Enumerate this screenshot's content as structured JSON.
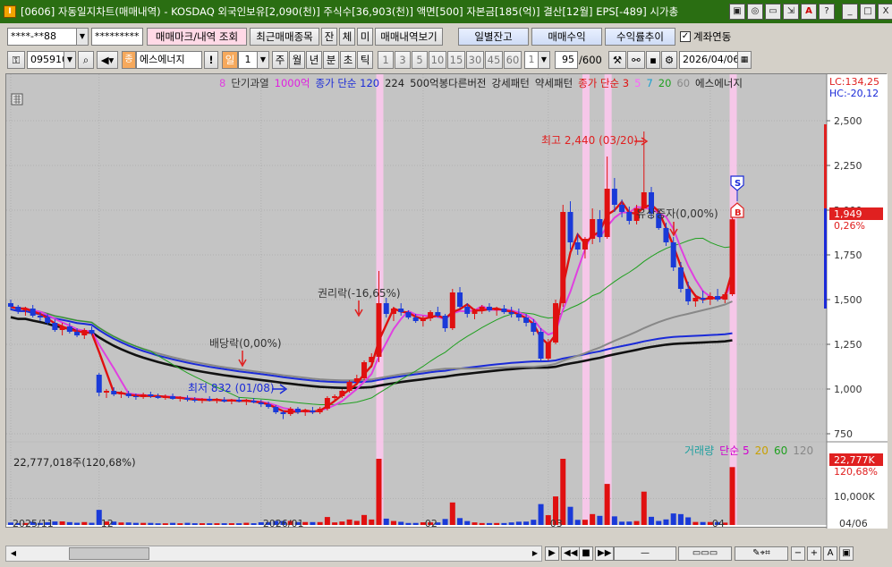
{
  "window": {
    "title": "[0606] 자동일지차트(매매내역) - KOSDAQ 외국인보유[2,090(천)] 주식수[36,903(천)] 액면[500] 자본금[185(억)] 결산[12월] EPS[-489] 시가총",
    "app_icon": "I",
    "buttons": [
      "▣",
      "◎",
      "▭",
      "⇲",
      "A",
      "?",
      "_",
      "□",
      "X"
    ]
  },
  "toolbar1": {
    "account_masked": "****-**88",
    "password_masked": "*********",
    "trade_mark_button": "매매마크/내역 조회",
    "recent_trades_button": "최근매매종목",
    "tab_jan": "잔",
    "tab_che": "체",
    "tab_mi": "미",
    "trade_history_button": "매매내역보기",
    "daily_balance_button": "일별잔고",
    "trade_profit_button": "매매수익",
    "return_trend_button": "수익률추이",
    "account_link_label": "계좌연동",
    "account_link_checked": "✓"
  },
  "toolbar2": {
    "stock_code": "095910",
    "stock_name": "에스에너지",
    "stock_badge": "종",
    "period_selected": "일",
    "period_count": "1",
    "periods": [
      "주",
      "월",
      "년",
      "분",
      "초",
      "틱"
    ],
    "intervals": [
      "1",
      "3",
      "5",
      "10",
      "15",
      "30",
      "45",
      "60"
    ],
    "interval_count": "1",
    "bar_count": "95",
    "bar_total": "/600",
    "date": "2026/04/06"
  },
  "chart_data": [
    {
      "type": "candlestick",
      "legend": [
        {
          "text": "8",
          "color": "#e040e0"
        },
        {
          "text": "단기과열",
          "color": "#333333"
        },
        {
          "text": "1000억",
          "color": "#e020e0"
        },
        {
          "text": "종가 단순 120",
          "color": "#1a2ad8"
        },
        {
          "text": "224",
          "color": "#222222"
        },
        {
          "text": "500억봉다른버전",
          "color": "#222222"
        },
        {
          "text": "강세패턴",
          "color": "#222222"
        },
        {
          "text": "약세패턴",
          "color": "#222222"
        },
        {
          "text": "종가 단순 3",
          "color": "#e01010"
        },
        {
          "text": "5",
          "color": "#ff60ff"
        },
        {
          "text": "7",
          "color": "#18a0d0"
        },
        {
          "text": "20",
          "color": "#20a020"
        },
        {
          "text": "60",
          "color": "#888888"
        },
        {
          "text": "에스에너지",
          "color": "#222222"
        }
      ],
      "y_ticks": [
        "2,500",
        "2,250",
        "2,000",
        "1,750",
        "1,500",
        "1,250",
        "1,000",
        "750"
      ],
      "ylim": [
        760,
        2560
      ],
      "x_ticks": [
        {
          "label": "2025/11",
          "i": 0
        },
        {
          "label": "12",
          "i": 12
        },
        {
          "label": "2026/01",
          "i": 34
        },
        {
          "label": "02",
          "i": 56
        },
        {
          "label": "03",
          "i": 73
        },
        {
          "label": "04",
          "i": 95
        },
        {
          "label": "04/06",
          "i": 114
        }
      ],
      "lc_label": "LC:134,25",
      "hc_label": "HC:-20,12",
      "current_price": "1,949",
      "current_change": "0,26%",
      "annotations": {
        "high": "최고 2,440 (03/20)",
        "low": "최저 832 (01/08)",
        "rights": "권리락(-16,65%)",
        "dividend": "배당락(0,00%)",
        "capital_increase": "유상증자(0,00%)",
        "sell_marker": "S",
        "buy_marker": "B"
      },
      "highlight_bars": [
        50,
        78,
        81,
        98
      ],
      "candles": [
        [
          1480,
          1500,
          1440,
          1460
        ],
        [
          1460,
          1470,
          1420,
          1440
        ],
        [
          1440,
          1460,
          1410,
          1450
        ],
        [
          1450,
          1470,
          1400,
          1410
        ],
        [
          1410,
          1430,
          1380,
          1400
        ],
        [
          1400,
          1420,
          1360,
          1370
        ],
        [
          1370,
          1390,
          1320,
          1330
        ],
        [
          1330,
          1370,
          1300,
          1350
        ],
        [
          1350,
          1370,
          1310,
          1320
        ],
        [
          1320,
          1340,
          1290,
          1300
        ],
        [
          1300,
          1340,
          1280,
          1330
        ],
        [
          1330,
          1350,
          1300,
          1310
        ],
        [
          1080,
          1090,
          960,
          980
        ],
        [
          980,
          1000,
          950,
          990
        ],
        [
          990,
          1010,
          960,
          970
        ],
        [
          970,
          990,
          950,
          975
        ],
        [
          975,
          990,
          950,
          960
        ],
        [
          960,
          975,
          940,
          955
        ],
        [
          955,
          980,
          945,
          970
        ],
        [
          970,
          985,
          950,
          960
        ],
        [
          960,
          975,
          945,
          950
        ],
        [
          950,
          970,
          940,
          960
        ],
        [
          960,
          975,
          940,
          945
        ],
        [
          945,
          960,
          930,
          950
        ],
        [
          950,
          965,
          930,
          940
        ],
        [
          940,
          955,
          925,
          935
        ],
        [
          935,
          950,
          920,
          945
        ],
        [
          945,
          960,
          930,
          935
        ],
        [
          935,
          950,
          920,
          940
        ],
        [
          940,
          955,
          925,
          930
        ],
        [
          930,
          945,
          915,
          940
        ],
        [
          940,
          955,
          925,
          930
        ],
        [
          930,
          945,
          910,
          935
        ],
        [
          935,
          950,
          920,
          925
        ],
        [
          925,
          940,
          900,
          915
        ],
        [
          915,
          930,
          890,
          900
        ],
        [
          900,
          910,
          860,
          870
        ],
        [
          870,
          880,
          832,
          860
        ],
        [
          860,
          900,
          850,
          890
        ],
        [
          890,
          900,
          860,
          870
        ],
        [
          870,
          890,
          850,
          880
        ],
        [
          880,
          900,
          860,
          870
        ],
        [
          870,
          900,
          860,
          890
        ],
        [
          890,
          960,
          880,
          950
        ],
        [
          950,
          970,
          930,
          960
        ],
        [
          960,
          1000,
          950,
          990
        ],
        [
          990,
          1050,
          980,
          1040
        ],
        [
          1040,
          1080,
          1020,
          1060
        ],
        [
          1060,
          1160,
          1050,
          1150
        ],
        [
          1150,
          1200,
          1120,
          1180
        ],
        [
          1180,
          1660,
          1150,
          1480
        ],
        [
          1480,
          1510,
          1400,
          1420
        ],
        [
          1420,
          1460,
          1380,
          1450
        ],
        [
          1450,
          1480,
          1410,
          1430
        ],
        [
          1430,
          1440,
          1390,
          1400
        ],
        [
          1400,
          1420,
          1370,
          1380
        ],
        [
          1380,
          1410,
          1350,
          1395
        ],
        [
          1395,
          1440,
          1380,
          1430
        ],
        [
          1430,
          1460,
          1400,
          1410
        ],
        [
          1410,
          1420,
          1320,
          1340
        ],
        [
          1340,
          1560,
          1330,
          1540
        ],
        [
          1540,
          1570,
          1450,
          1460
        ],
        [
          1460,
          1480,
          1400,
          1420
        ],
        [
          1420,
          1450,
          1390,
          1440
        ],
        [
          1440,
          1470,
          1420,
          1460
        ],
        [
          1460,
          1480,
          1430,
          1440
        ],
        [
          1440,
          1460,
          1410,
          1450
        ],
        [
          1450,
          1470,
          1420,
          1430
        ],
        [
          1430,
          1460,
          1400,
          1420
        ],
        [
          1420,
          1450,
          1380,
          1400
        ],
        [
          1400,
          1420,
          1350,
          1370
        ],
        [
          1370,
          1390,
          1300,
          1320
        ],
        [
          1320,
          1340,
          1150,
          1170
        ],
        [
          1170,
          1280,
          1160,
          1260
        ],
        [
          1260,
          1500,
          1250,
          1480
        ],
        [
          1480,
          2030,
          1460,
          1990
        ],
        [
          1990,
          2050,
          1780,
          1820
        ],
        [
          1820,
          1870,
          1750,
          1780
        ],
        [
          1780,
          1850,
          1730,
          1840
        ],
        [
          1840,
          2010,
          1810,
          1950
        ],
        [
          1950,
          2000,
          1820,
          1850
        ],
        [
          1850,
          2300,
          1840,
          2120
        ],
        [
          2120,
          2180,
          1990,
          2030
        ],
        [
          2030,
          2060,
          1960,
          1990
        ],
        [
          1990,
          2020,
          1920,
          1940
        ],
        [
          1940,
          2030,
          1920,
          2010
        ],
        [
          2010,
          2440,
          2000,
          2100
        ],
        [
          2100,
          2130,
          1950,
          1980
        ],
        [
          1980,
          2000,
          1890,
          1900
        ],
        [
          1900,
          1930,
          1800,
          1820
        ],
        [
          1820,
          1850,
          1660,
          1680
        ],
        [
          1680,
          1710,
          1540,
          1560
        ],
        [
          1560,
          1600,
          1470,
          1490
        ],
        [
          1490,
          1530,
          1460,
          1510
        ],
        [
          1510,
          1550,
          1480,
          1500
        ],
        [
          1500,
          1540,
          1470,
          1520
        ],
        [
          1520,
          1560,
          1490,
          1500
        ],
        [
          1500,
          1540,
          1480,
          1530
        ],
        [
          1530,
          1990,
          1520,
          1949
        ]
      ],
      "volume": {
        "label": "22,777,018주(120,68%)",
        "legend": [
          {
            "text": "거래량",
            "color": "#20a0a0"
          },
          {
            "text": "단순 5",
            "color": "#d000d0"
          },
          {
            "text": "20",
            "color": "#c8a000"
          },
          {
            "text": "60",
            "color": "#20a020"
          },
          {
            "text": "120",
            "color": "#888888"
          }
        ],
        "tick": "10,000K",
        "ylim": [
          0,
          25000
        ],
        "current": "22,777K",
        "current_pct": "120,68%"
      }
    }
  ],
  "footer": {
    "buttons": [
      "▶",
      "◀◀",
      "■",
      "▶▶",
      "—",
      "+",
      "A",
      "▣"
    ]
  }
}
